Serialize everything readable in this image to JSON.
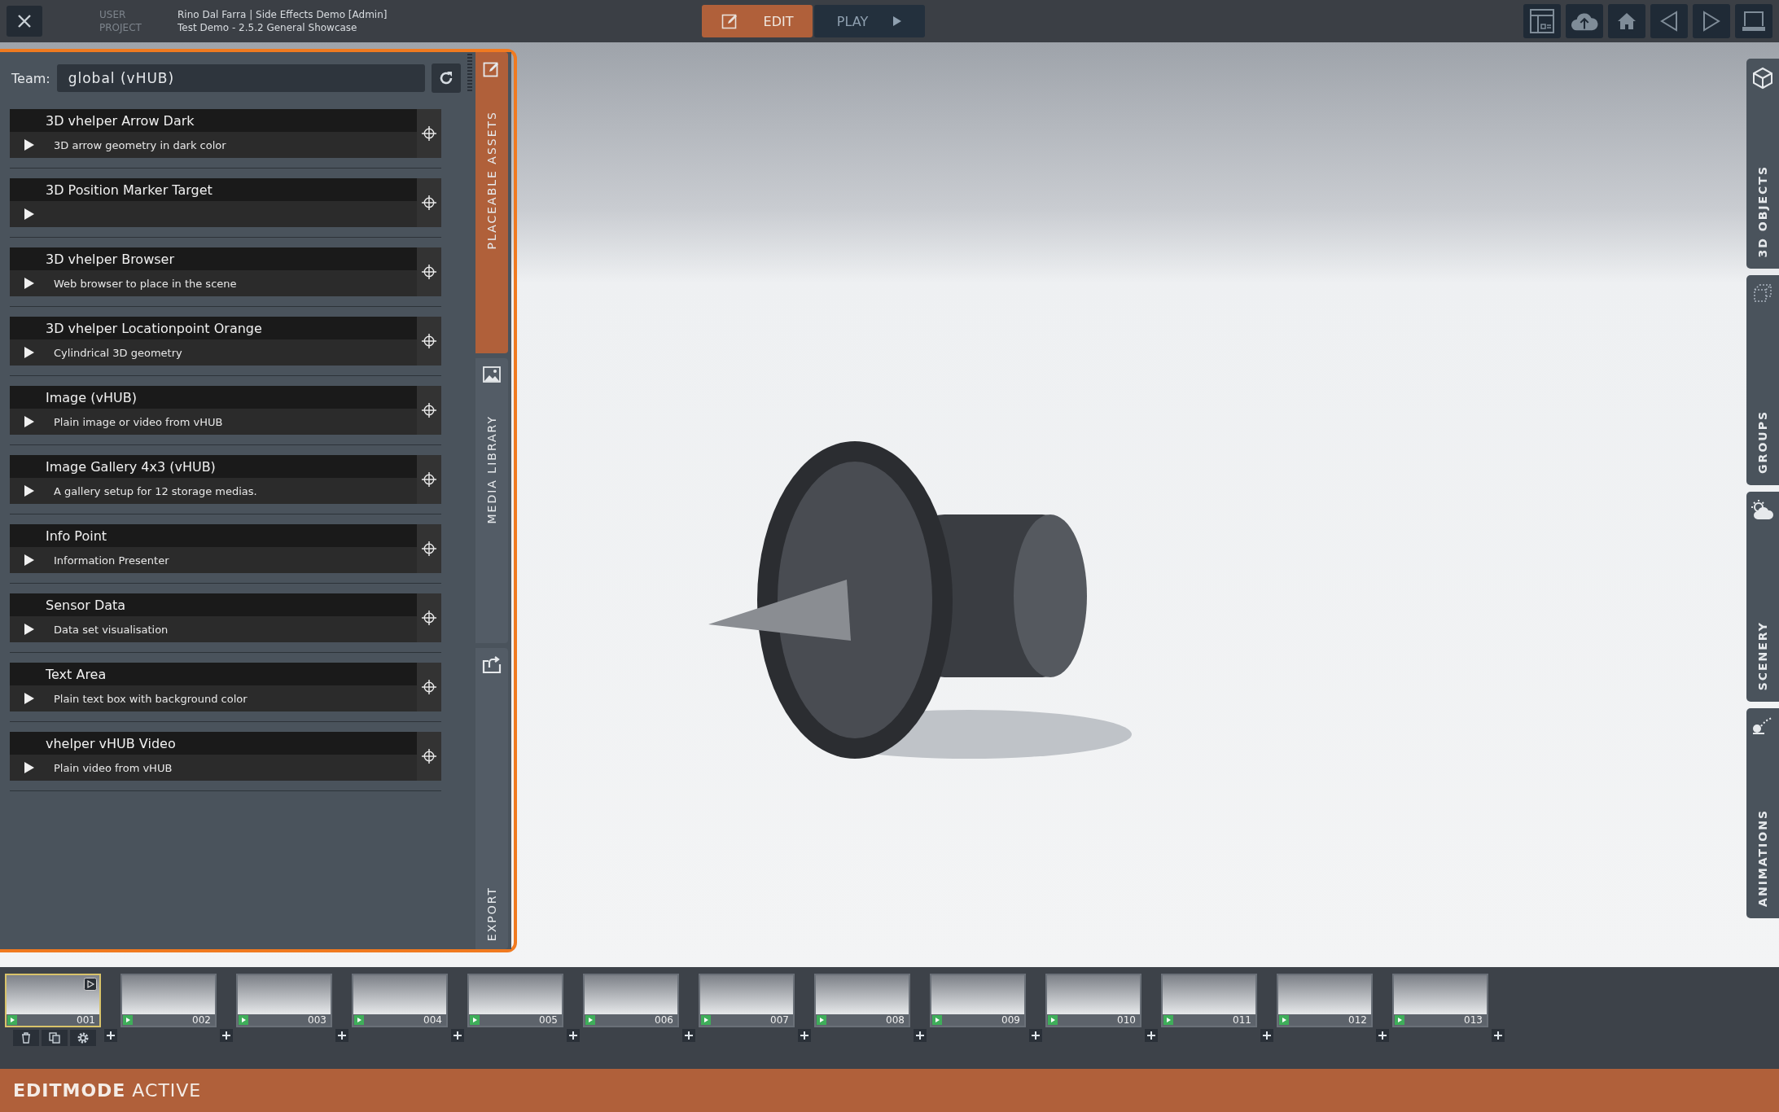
{
  "top_bar": {
    "user_label": "USER",
    "user": "Rino Dal Farra | Side Effects Demo [Admin]",
    "project_label": "PROJECT",
    "project": "Test Demo - 2.5.2 General Showcase"
  },
  "mode_buttons": [
    {
      "label": "EDIT",
      "selected": true
    },
    {
      "label": "PLAY",
      "selected": false
    }
  ],
  "left_panel": {
    "team_label": "Team:",
    "team_value": "global (vHUB)",
    "assets": [
      {
        "title": "3D vhelper Arrow Dark",
        "description": "3D arrow geometry in dark color"
      },
      {
        "title": "3D Position Marker Target"
      },
      {
        "title": "3D vhelper Browser",
        "description": "Web browser to place in the scene"
      },
      {
        "title": "3D vhelper Locationpoint Orange",
        "description": "Cylindrical 3D geometry"
      },
      {
        "title": "Image (vHUB)",
        "description": "Plain image or video from vHUB"
      },
      {
        "title": "Image Gallery 4x3 (vHUB)",
        "description": "A gallery setup for 12 storage medias."
      },
      {
        "title": "Info Point",
        "description": "Information Presenter"
      },
      {
        "title": "Sensor Data",
        "description": "Data set visualisation"
      },
      {
        "title": "Text Area",
        "description": "Plain text box with background color"
      },
      {
        "title": "vhelper vHUB Video",
        "description": "Plain video from vHUB"
      }
    ]
  },
  "left_tabs": [
    {
      "label": "PLACEABLE ASSETS",
      "selected": true
    },
    {
      "label": "MEDIA LIBRARY",
      "selected": false
    },
    {
      "label": "EXPORT",
      "selected": false
    }
  ],
  "right_tabs": [
    {
      "label": "3D OBJECTS"
    },
    {
      "label": "GROUPS"
    },
    {
      "label": "SCENERY"
    },
    {
      "label": "ANIMATIONS"
    }
  ],
  "timeline": {
    "slides": [
      {
        "number": "001",
        "selected": true
      },
      {
        "number": "002",
        "selected": false
      },
      {
        "number": "003",
        "selected": false
      },
      {
        "number": "004",
        "selected": false
      },
      {
        "number": "005",
        "selected": false
      },
      {
        "number": "006",
        "selected": false
      },
      {
        "number": "007",
        "selected": false
      },
      {
        "number": "008",
        "selected": false
      },
      {
        "number": "009",
        "selected": false
      },
      {
        "number": "010",
        "selected": false
      },
      {
        "number": "011",
        "selected": false
      },
      {
        "number": "012",
        "selected": false
      },
      {
        "number": "013",
        "selected": false
      }
    ]
  },
  "status_bar": {
    "text": "**EDITMODE** ACTIVE"
  }
}
